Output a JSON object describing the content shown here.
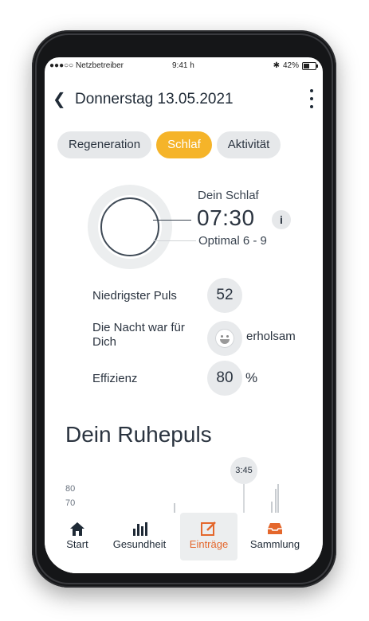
{
  "status_bar": {
    "carrier": "●●●○○ Netzbetreiber",
    "time": "9:41 h",
    "battery": "42%"
  },
  "header": {
    "title": "Donnerstag 13.05.2021"
  },
  "tabs": [
    {
      "label": "Regeneration",
      "active": false
    },
    {
      "label": "Schlaf",
      "active": true
    },
    {
      "label": "Aktivität",
      "active": false
    }
  ],
  "sleep": {
    "label": "Dein Schlaf",
    "duration": "07:30",
    "info": "i",
    "optimal": "Optimal 6 - 9"
  },
  "metrics": {
    "lowest_pulse_label": "Niedrigster Puls",
    "lowest_pulse_value": "52",
    "night_label": "Die Nacht war für Dich",
    "night_value": "erholsam",
    "efficiency_label": "Effizienz",
    "efficiency_value": "80",
    "efficiency_unit": "%"
  },
  "resting_pulse": {
    "title": "Dein Ruhepuls",
    "marker_time": "3:45",
    "y_ticks": [
      "80",
      "70"
    ]
  },
  "bottom_nav": [
    {
      "label": "Start",
      "icon": "home-icon",
      "active": false
    },
    {
      "label": "Gesundheit",
      "icon": "bar-chart-icon",
      "active": false
    },
    {
      "label": "Einträge",
      "icon": "edit-icon",
      "active": true
    },
    {
      "label": "Sammlung",
      "icon": "inbox-icon",
      "active": false
    }
  ],
  "colors": {
    "accent": "#f5b429",
    "active_nav": "#e4672c",
    "text": "#2b3440"
  }
}
